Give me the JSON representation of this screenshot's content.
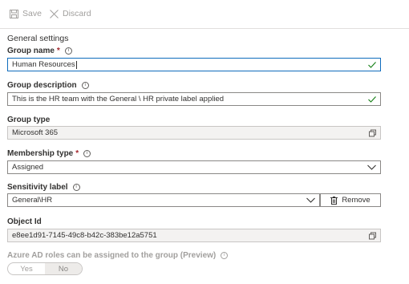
{
  "toolbar": {
    "save_label": "Save",
    "discard_label": "Discard",
    "save_icon": "floppy-disk-icon",
    "discard_icon": "close-x-icon"
  },
  "section_title": "General settings",
  "group_name": {
    "label": "Group name",
    "required_marker": "*",
    "value": "Human Resources",
    "valid": true
  },
  "group_description": {
    "label": "Group description",
    "value": "This is the HR team with the General \\ HR private label applied",
    "valid": true
  },
  "group_type": {
    "label": "Group type",
    "value": "Microsoft 365"
  },
  "membership_type": {
    "label": "Membership type",
    "required_marker": "*",
    "selected": "Assigned"
  },
  "sensitivity_label": {
    "label": "Sensitivity label",
    "selected": "General\\HR",
    "remove_label": "Remove"
  },
  "object_id": {
    "label": "Object Id",
    "value": "e8ee1d91-7145-49c8-b42c-383be12a5751"
  },
  "azure_ad_roles": {
    "label": "Azure AD roles can be assigned to the group (Preview)",
    "options": [
      "Yes",
      "No"
    ],
    "selected": "No"
  },
  "colors": {
    "accent": "#0f6cbd",
    "valid_check": "#107c10",
    "required": "#a4262c",
    "disabled_text": "#a19f9d"
  }
}
